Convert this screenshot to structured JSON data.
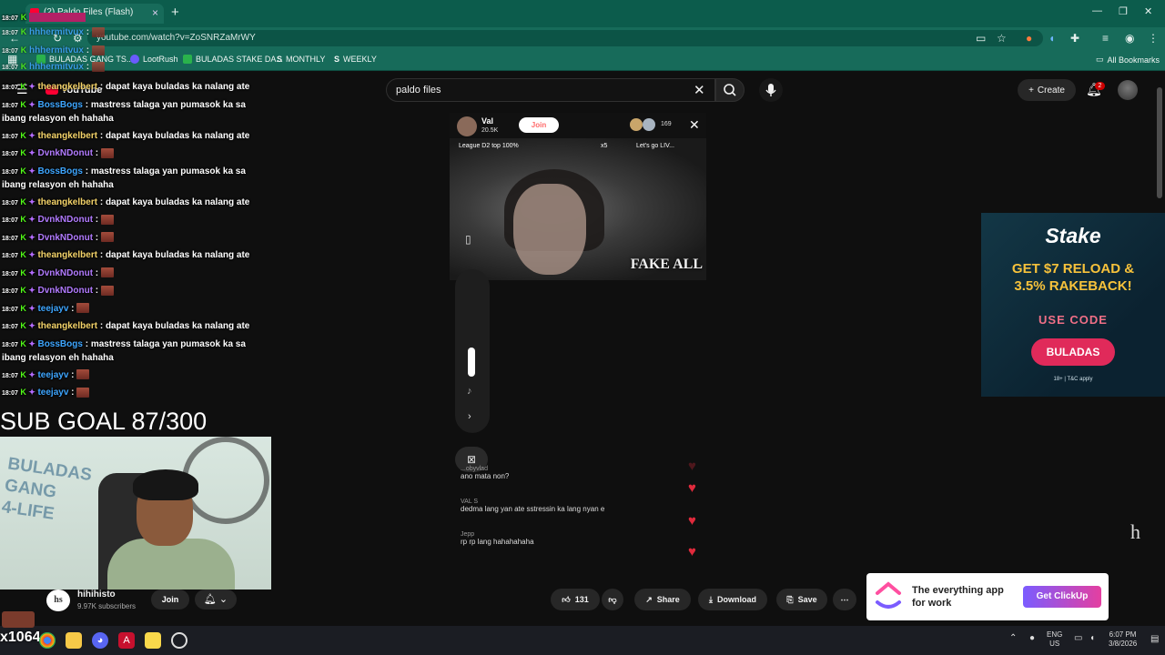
{
  "browser": {
    "tab_title": "(2) Paldo Files (Flash)",
    "url": "youtube.com/watch?v=ZoSNRZaMrWY",
    "bookmarks": [
      "BULADAS GANG TS...",
      "LootRush",
      "BULADAS STAKE DA...",
      "MONTHLY",
      "WEEKLY"
    ],
    "all_bookmarks": "All Bookmarks"
  },
  "youtube": {
    "logo": "YouTube",
    "search_query": "paldo files",
    "create_label": "Create",
    "notifications_count": "2"
  },
  "chat": {
    "ghost_rows": [
      {
        "user": "hhhermitvux",
        "time": "18:07"
      },
      {
        "user": "hhhermitvux",
        "time": "18:07"
      },
      {
        "user": "hhhermitvux",
        "time": "18:07"
      }
    ],
    "messages": [
      {
        "time": "18:07",
        "user": "theangkelbert",
        "text": "dapat kaya buladas ka nalang ate",
        "color": "#f5d46a"
      },
      {
        "time": "18:07",
        "user": "BossBogs",
        "text": "mastress talaga yan pumasok ka sa ibang relasyon eh hahaha",
        "color": "#3ea6ff"
      },
      {
        "time": "18:07",
        "user": "theangkelbert",
        "text": "dapat kaya buladas ka nalang ate",
        "color": "#f5d46a"
      },
      {
        "time": "18:07",
        "user": "DvnkNDonut",
        "text": "",
        "color": "#b27bff"
      },
      {
        "time": "18:07",
        "user": "BossBogs",
        "text": "mastress talaga yan pumasok ka sa ibang relasyon eh hahaha",
        "color": "#3ea6ff"
      },
      {
        "time": "18:07",
        "user": "theangkelbert",
        "text": "dapat kaya buladas ka nalang ate",
        "color": "#f5d46a"
      },
      {
        "time": "18:07",
        "user": "DvnkNDonut",
        "text": "",
        "color": "#b27bff"
      },
      {
        "time": "18:07",
        "user": "DvnkNDonut",
        "text": "",
        "color": "#b27bff"
      },
      {
        "time": "18:07",
        "user": "theangkelbert",
        "text": "dapat kaya buladas ka nalang ate",
        "color": "#f5d46a"
      },
      {
        "time": "18:07",
        "user": "DvnkNDonut",
        "text": "",
        "color": "#b27bff"
      },
      {
        "time": "18:07",
        "user": "DvnkNDonut",
        "text": "",
        "color": "#b27bff"
      },
      {
        "time": "18:07",
        "user": "teejayv",
        "text": "",
        "color": "#3ea6ff"
      },
      {
        "time": "18:07",
        "user": "theangkelbert",
        "text": "dapat kaya buladas ka nalang ate",
        "color": "#f5d46a"
      },
      {
        "time": "18:07",
        "user": "BossBogs",
        "text": "mastress talaga yan pumasok ka sa ibang relasyon eh hahaha",
        "color": "#3ea6ff"
      },
      {
        "time": "18:07",
        "user": "teejayv",
        "text": "",
        "color": "#3ea6ff"
      },
      {
        "time": "18:07",
        "user": "teejayv",
        "text": "",
        "color": "#3ea6ff"
      }
    ]
  },
  "overlay": {
    "sub_goal": "SUB GOAL 87/300",
    "kick_total": "x1064"
  },
  "video": {
    "streamer_name": "Val",
    "streamer_likes": "20.5K",
    "join_label": "Join",
    "viewers": "169",
    "league": "League D2 top 100%",
    "multiplier": "x5",
    "lets_go": "Let's go LIV...",
    "caption": "FAKE ALL",
    "comments": [
      {
        "user": "...obyvlad",
        "text": "ano mata non?"
      },
      {
        "user": "VAL S",
        "text": "dedma lang yan ate sstressin ka lang nyan e"
      },
      {
        "user": "Jepp",
        "text": "rp rp lang hahahahaha"
      }
    ]
  },
  "channel": {
    "avatar_text": "hs",
    "name": "hihihisto",
    "subscribers": "9.97K subscribers",
    "join_label": "Join"
  },
  "actions": {
    "likes": "131",
    "share": "Share",
    "download": "Download",
    "save": "Save"
  },
  "ads": {
    "stake": {
      "logo": "Stake",
      "headline_1": "GET $7 RELOAD &",
      "headline_2": "3.5% RAKEBACK!",
      "use_code": "USE CODE",
      "code": "BULADAS",
      "legal": "18+ | T&C apply"
    },
    "clickup": {
      "line1": "The everything app",
      "line2": "for work",
      "button": "Get ClickUp"
    },
    "corner_logo": "h"
  },
  "taskbar": {
    "lang_1": "ENG",
    "lang_2": "US",
    "time": "6:07 PM",
    "date": "3/8/2026"
  }
}
